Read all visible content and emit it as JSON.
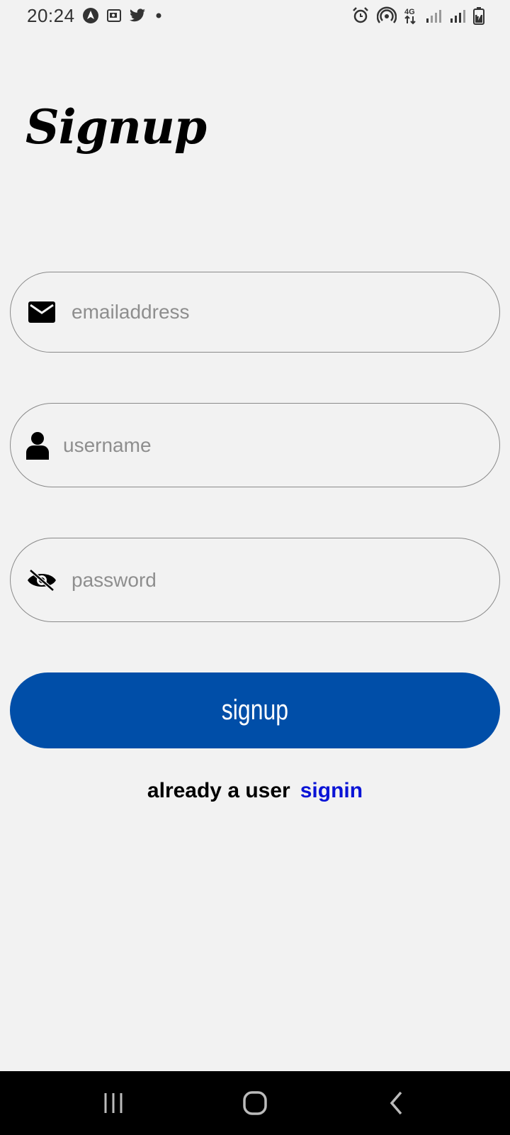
{
  "status_bar": {
    "time": "20:24",
    "icons_left": [
      "navigation-arrow-icon",
      "screen-record-icon",
      "twitter-icon",
      "notification-dot-icon"
    ],
    "icons_right": [
      "alarm-icon",
      "hotspot-icon",
      "4g-icon",
      "signal-icon",
      "signal-icon-2",
      "battery-icon"
    ],
    "network_label": "4G"
  },
  "page": {
    "title": "Signup"
  },
  "form": {
    "email": {
      "placeholder": "emailaddress",
      "value": "",
      "icon": "mail-icon"
    },
    "username": {
      "placeholder": "username",
      "value": "",
      "icon": "person-icon"
    },
    "password": {
      "placeholder": "password",
      "value": "",
      "icon": "eye-off-icon"
    },
    "submit_label": "signup"
  },
  "signin": {
    "prompt": "already a user",
    "link_label": "signin"
  },
  "nav_bar": {
    "buttons": [
      "recent-apps-icon",
      "home-icon",
      "back-icon"
    ]
  },
  "colors": {
    "background": "#f2f2f2",
    "button": "#004ea8",
    "link": "#0a14d6",
    "field_border": "#8a8a8a",
    "placeholder": "#8e8e8e"
  }
}
